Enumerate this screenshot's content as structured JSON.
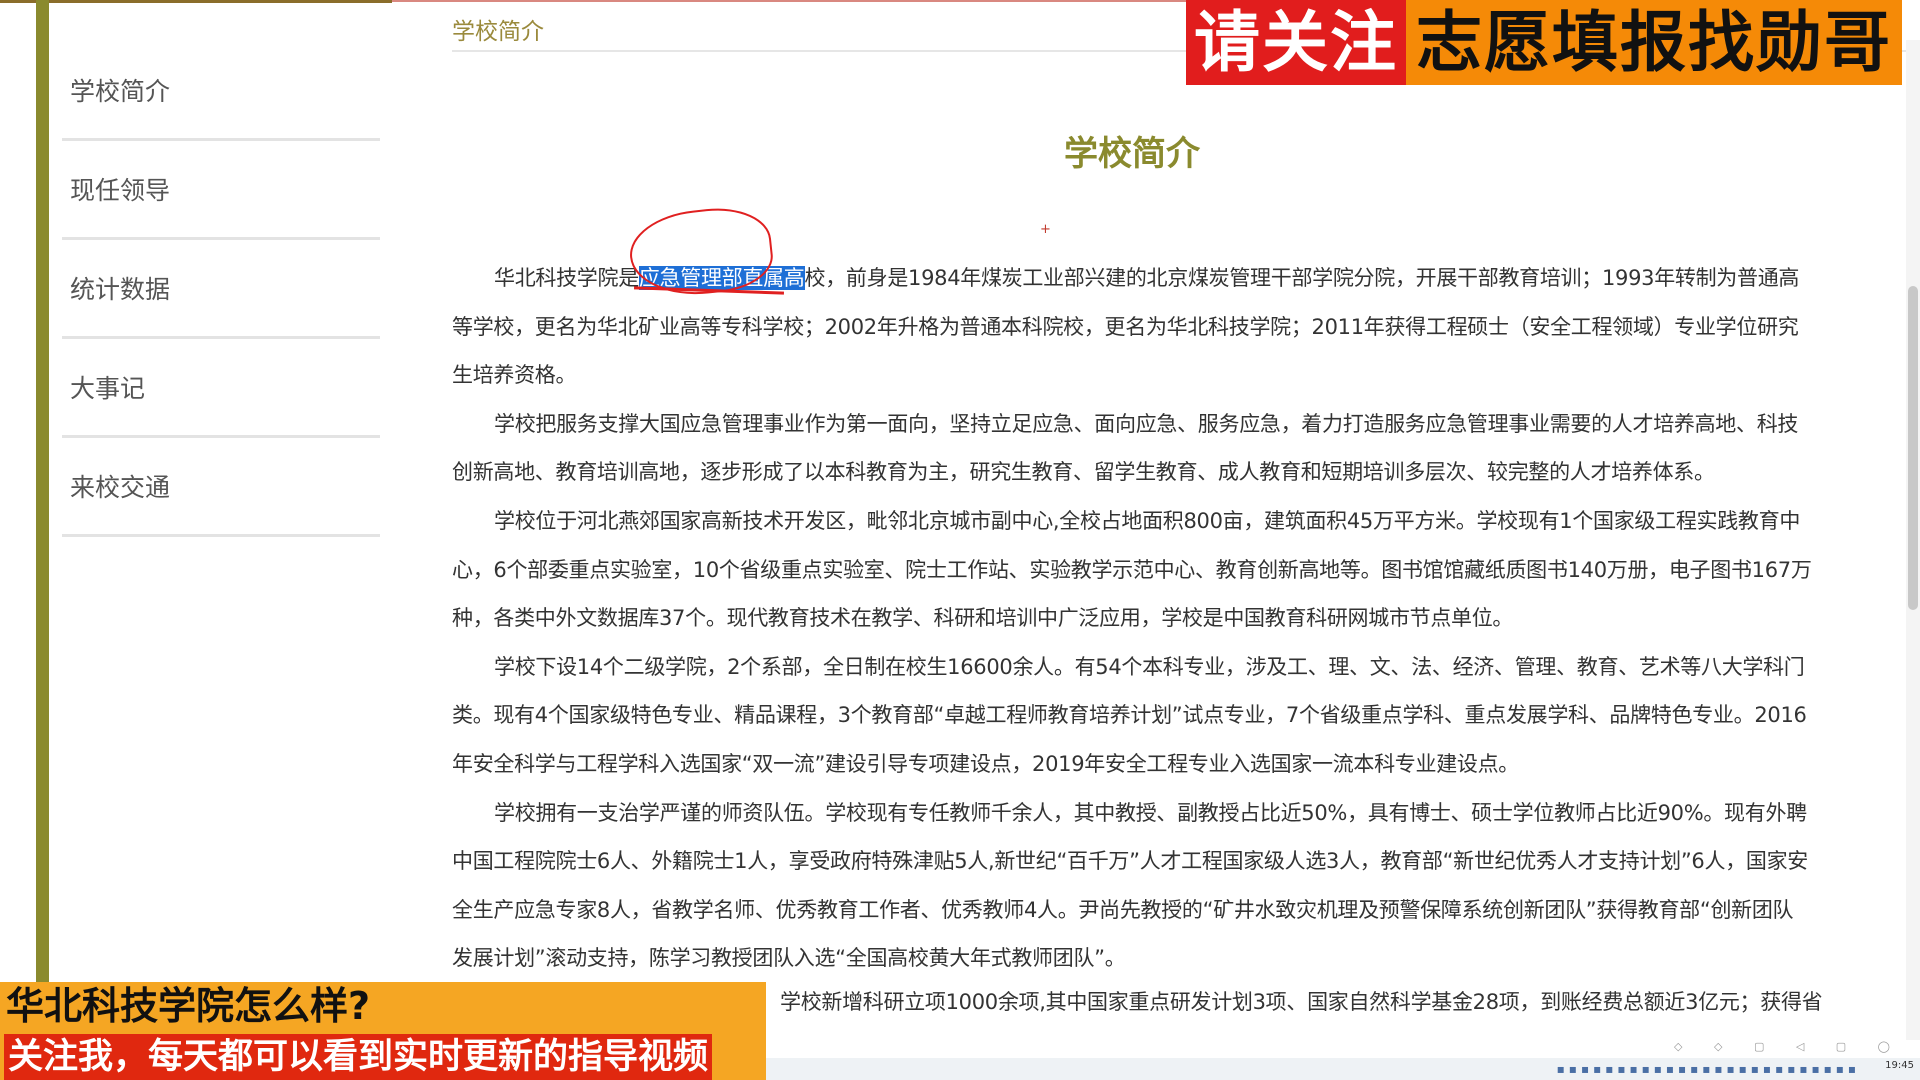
{
  "breadcrumb": "学校简介",
  "sidebar": {
    "items": [
      {
        "label": "学校简介"
      },
      {
        "label": "现任领导"
      },
      {
        "label": "统计数据"
      },
      {
        "label": "大事记"
      },
      {
        "label": "来校交通"
      }
    ]
  },
  "page_title": "学校简介",
  "paragraphs": {
    "p1_pre": "华北科技学院是",
    "p1_hl": "应急管理部直属高",
    "p1_post": "校，前身是1984年煤炭工业部兴建的北京煤炭管理干部学院分院，开展干部教育培训；1993年转制为普通高等学校，更名为华北矿业高等专科学校；2002年升格为普通本科院校，更名为华北科技学院；2011年获得工程硕士（安全工程领域）专业学位研究生培养资格。",
    "p2": "学校把服务支撑大国应急管理事业作为第一面向，坚持立足应急、面向应急、服务应急，着力打造服务应急管理事业需要的人才培养高地、科技创新高地、教育培训高地，逐步形成了以本科教育为主，研究生教育、留学生教育、成人教育和短期培训多层次、较完整的人才培养体系。",
    "p3": "学校位于河北燕郊国家高新技术开发区，毗邻北京城市副中心,全校占地面积800亩，建筑面积45万平方米。学校现有1个国家级工程实践教育中心，6个部委重点实验室，10个省级重点实验室、院士工作站、实验教学示范中心、教育创新高地等。图书馆馆藏纸质图书140万册，电子图书167万种，各类中外文数据库37个。现代教育技术在教学、科研和培训中广泛应用，学校是中国教育科研网城市节点单位。",
    "p4": "学校下设14个二级学院，2个系部，全日制在校生16600余人。有54个本科专业，涉及工、理、文、法、经济、管理、教育、艺术等八大学科门类。现有4个国家级特色专业、精品课程，3个教育部“卓越工程师教育培养计划”试点专业，7个省级重点学科、重点发展学科、品牌特色专业。2016年安全科学与工程学科入选国家“双一流”建设引导专项建设点，2019年安全工程专业入选国家一流本科专业建设点。",
    "p5": "学校拥有一支治学严谨的师资队伍。学校现有专任教师千余人，其中教授、副教授占比近50%，具有博士、硕士学位教师占比近90%。现有外聘中国工程院院士6人、外籍院士1人，享受政府特殊津贴5人,新世纪“百千万”人才工程国家级人选3人，教育部“新世纪优秀人才支持计划”6人，国家安全生产应急专家8人，省教学名师、优秀教育工作者、优秀教师4人。尹尚先教授的“矿井水致灾机理及预警保障系统创新团队”获得教育部“创新团队发展计划”滚动支持，陈学习教授团队入选“全国高校黄大年式教师团队”。",
    "p6_partial": "学校新增科研立项1000余项,其中国家重点研发计划3项、国家自然科学基金28项，到账经费总额近3亿元；获得省"
  },
  "banner": {
    "red_text": "请关注",
    "orange_text": "志愿填报找勋哥"
  },
  "caption": {
    "line1": "华北科技学院怎么样?",
    "line2": "关注我，每天都可以看到实时更新的指导视频"
  },
  "taskbar": {
    "time": "19:45"
  },
  "colors": {
    "accent": "#8a8a2e",
    "highlight": "#1e6fd6",
    "banner_red": "#e11d1d",
    "banner_orange": "#f58a07",
    "caption_bg": "#f5a623"
  }
}
